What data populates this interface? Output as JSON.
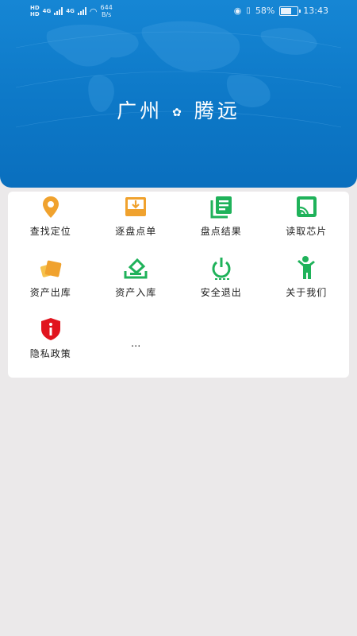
{
  "status_bar": {
    "hd1": "HD",
    "hd2": "HD",
    "net1": "4G",
    "net2": "4G",
    "speed_value": "644",
    "speed_unit": "B/s",
    "battery": "58%",
    "time": "13:43"
  },
  "banner": {
    "left": "广州",
    "right": "腾远"
  },
  "menu": [
    {
      "label": "查找定位",
      "icon": "location-pin-icon",
      "color": "#f0a22e"
    },
    {
      "label": "逐盘点单",
      "icon": "inbox-tray-icon",
      "color": "#f0a22e"
    },
    {
      "label": "盘点结果",
      "icon": "document-list-icon",
      "color": "#1fb25a"
    },
    {
      "label": "读取芯片",
      "icon": "cast-screen-icon",
      "color": "#1fb25a"
    },
    {
      "label": "资产出库",
      "icon": "asset-cards-icon",
      "color": "#f0a22e"
    },
    {
      "label": "资产入库",
      "icon": "stack-in-icon",
      "color": "#1fb25a"
    },
    {
      "label": "安全退出",
      "icon": "power-icon",
      "color": "#1fb25a"
    },
    {
      "label": "关于我们",
      "icon": "person-icon",
      "color": "#1fb25a"
    },
    {
      "label": "隐私政策",
      "icon": "shield-info-icon",
      "color": "#e1141e"
    },
    {
      "label": "..."
    }
  ]
}
